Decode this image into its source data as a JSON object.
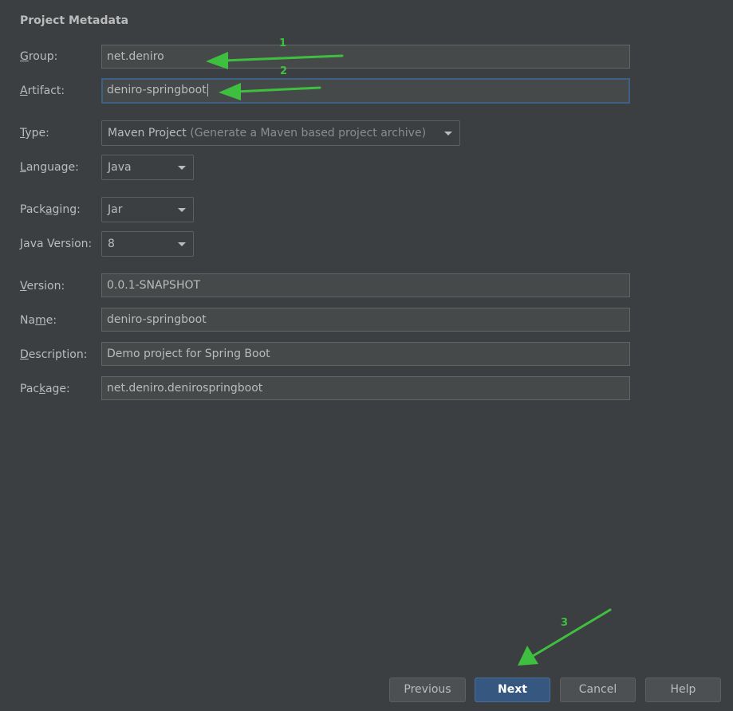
{
  "section": {
    "title": "Project Metadata"
  },
  "fields": {
    "group": {
      "label_mnemonic": "G",
      "label_rest": "roup:",
      "value": "net.deniro"
    },
    "artifact": {
      "label_pre": "",
      "label_mnemonic": "A",
      "label_rest": "rtifact:",
      "value": "deniro-springboot"
    },
    "type": {
      "label_mnemonic": "T",
      "label_rest": "ype:",
      "value": "Maven Project",
      "hint": " (Generate a Maven based project archive)"
    },
    "language": {
      "label_mnemonic": "L",
      "label_rest": "anguage:",
      "value": "Java"
    },
    "packaging": {
      "label_pre": "Pack",
      "label_mnemonic": "a",
      "label_rest": "ging:",
      "value": "Jar"
    },
    "java_version": {
      "label_mnemonic": "J",
      "label_rest": "ava Version:",
      "value": "8"
    },
    "version": {
      "label_mnemonic": "V",
      "label_rest": "ersion:",
      "value": "0.0.1-SNAPSHOT"
    },
    "name": {
      "label_pre": "Na",
      "label_mnemonic": "m",
      "label_rest": "e:",
      "value": "deniro-springboot"
    },
    "description": {
      "label_mnemonic": "D",
      "label_rest": "escription:",
      "value": "Demo project for Spring Boot"
    },
    "package": {
      "label_pre": "Pac",
      "label_mnemonic": "k",
      "label_rest": "age:",
      "value": "net.deniro.denirospringboot"
    }
  },
  "buttons": {
    "previous": "Previous",
    "next": "Next",
    "cancel": "Cancel",
    "help": "Help"
  },
  "annotations": {
    "one": "1",
    "two": "2",
    "three": "3",
    "color": "#3fbf3f"
  },
  "colors": {
    "background": "#3c3f41",
    "field_background": "#45494a",
    "focus_border": "#3d6185",
    "primary_button": "#365880"
  }
}
